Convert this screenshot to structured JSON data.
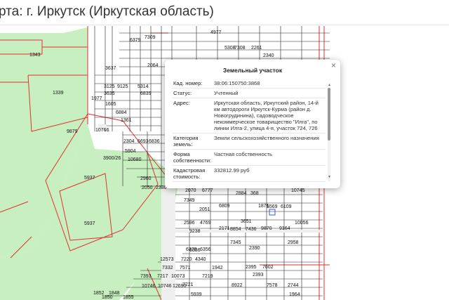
{
  "header": {
    "title": "рта: г. Иркутск (Иркутская область)"
  },
  "popup": {
    "title": "Земельный участок",
    "close_label": "×",
    "rows": [
      {
        "label": "Кад. номер:",
        "value": "38:06:150750:3868"
      },
      {
        "label": "Статус:",
        "value": "Учтенный"
      },
      {
        "label": "Адрес:",
        "value": "Иркутская область, Иркутский район, 14-й км автодороги Иркутск-Курма (район д. Новогрудинина), садоводческое некоммерческое товарищество \"Илга\", по линии Илга-2, улица 4-я, участок 724, 726"
      },
      {
        "label": "Категория земель:",
        "value": "Земли сельскохозяйственного назначения"
      },
      {
        "label": "Форма собственности:",
        "value": "Частная собственность"
      },
      {
        "label": "Кадастровая стоимость:",
        "value": "332812.99 руб"
      }
    ]
  },
  "map": {
    "colors": {
      "forest": "#c8efc0",
      "boundary": "#e03030",
      "parcel_line": "#222222",
      "road": "#e8e8e8"
    },
    "labels": [
      "1343",
      "1339",
      "9879",
      "3900/26",
      "5937",
      "5937",
      "1605",
      "1361",
      "10766",
      "2304",
      "6693",
      "6836",
      "5904",
      "10680",
      "2960",
      "2050",
      "2380",
      "2070",
      "6777",
      "2884",
      "368",
      "7349",
      "2051",
      "6809",
      "9238",
      "2596",
      "4769",
      "6370",
      "6356",
      "7345",
      "12573",
      "7220",
      "4340",
      "7332",
      "7571",
      "1942",
      "7393",
      "7217",
      "10073",
      "7221",
      "7219",
      "10746",
      "12690",
      "5939",
      "2171",
      "8854",
      "3651",
      "5569",
      "6109",
      "10056",
      "9164",
      "9870",
      "7436",
      "2958",
      "2390",
      "7602",
      "3125",
      "9125",
      "5314",
      "6884",
      "6839",
      "5308",
      "4977",
      "6379",
      "1977",
      "3635",
      "7308",
      "2261",
      "1871",
      "6356",
      "2395",
      "10746",
      "7578",
      "8922",
      "2744",
      "2393",
      "1848",
      "1852",
      "1850",
      "7309",
      "2340",
      "1855",
      "3637",
      "6304",
      "2064",
      "10745",
      "1964",
      "2070",
      "1939"
    ]
  }
}
